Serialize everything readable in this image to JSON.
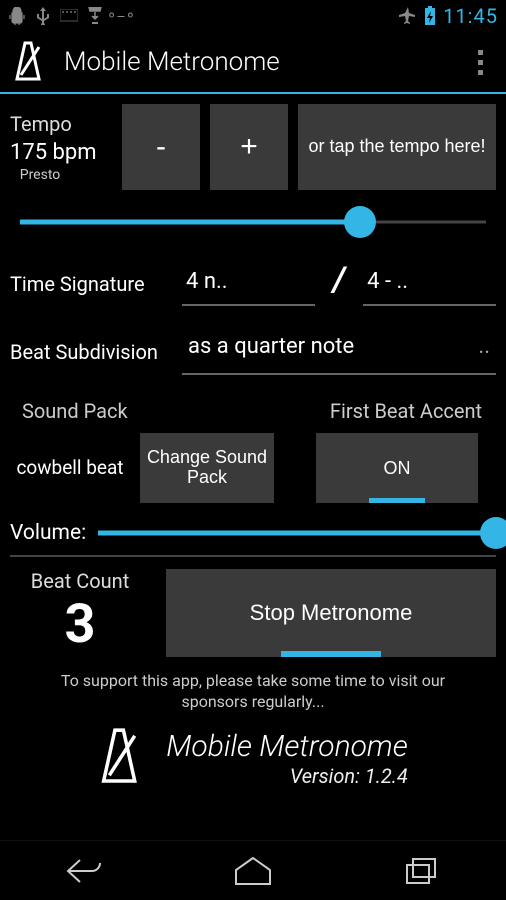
{
  "status": {
    "time": "11:45"
  },
  "app": {
    "title": "Mobile Metronome"
  },
  "tempo": {
    "label": "Tempo",
    "bpm": "175 bpm",
    "name": "Presto",
    "minus": "-",
    "plus": "+",
    "tap_label": "or tap the tempo here!",
    "slider_percent": 72
  },
  "time_signature": {
    "label": "Time Signature",
    "numerator_display": "4   n..",
    "denominator_display": "4  - ..",
    "numerator": 4,
    "denominator": 4
  },
  "subdivision": {
    "label": "Beat Subdivision",
    "value": "as a quarter note"
  },
  "sound_pack": {
    "header": "Sound Pack",
    "name": "cowbell beat",
    "change_label": "Change Sound Pack"
  },
  "first_beat_accent": {
    "header": "First Beat Accent",
    "state": "ON"
  },
  "volume": {
    "label": "Volume:",
    "percent": 100
  },
  "beat_count": {
    "label": "Beat Count",
    "value": "3"
  },
  "main_button": {
    "label": "Stop Metronome"
  },
  "support_text": "To support this app, please take some time to visit our sponsors regularly...",
  "footer": {
    "title": "Mobile Metronome",
    "version": "Version:  1.2.4"
  }
}
